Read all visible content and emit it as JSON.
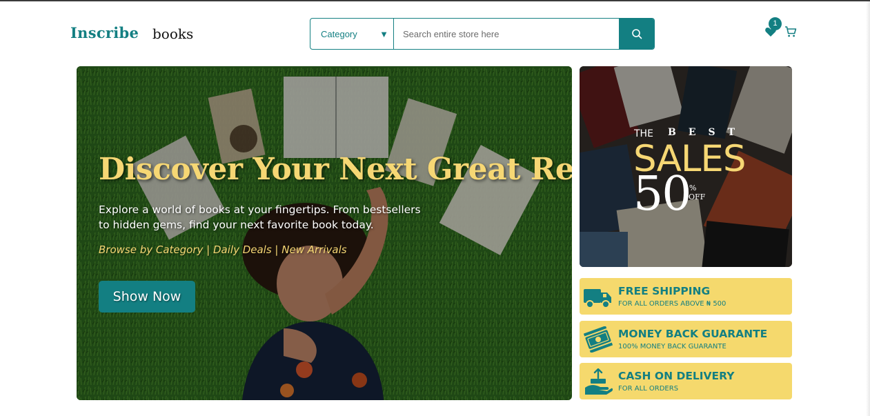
{
  "header": {
    "logo": "Inscribe",
    "logo_sub": "books",
    "category_label": "Category",
    "search_placeholder": "Search entire store here",
    "wishlist_count": "1"
  },
  "hero": {
    "title": "Discover Your Next Great Read",
    "description": "Explore a world of books at your fingertips. From bestsellers to hidden gems, find your next favorite book today.",
    "links": "Browse by Category | Daily Deals | New Arrivals",
    "button_label": "Show Now"
  },
  "promo": {
    "the": "THE",
    "best": "BEST",
    "sales": "SALES",
    "discount": "50",
    "percent": "%",
    "off": "OFF"
  },
  "features": [
    {
      "title": "FREE SHIPPING",
      "subtitle": "FOR ALL ORDERS ABOVE ₦ 500",
      "icon": "truck-icon"
    },
    {
      "title": "MONEY BACK GUARANTE",
      "subtitle": "100% MONEY BACK GUARANTE",
      "icon": "money-icon"
    },
    {
      "title": "CASH ON DELIVERY",
      "subtitle": "FOR ALL ORDERS",
      "icon": "cash-hand-icon"
    }
  ],
  "colors": {
    "brand_teal": "#137f82",
    "accent_yellow": "#f6d774",
    "feature_bg": "#f5d96d"
  }
}
